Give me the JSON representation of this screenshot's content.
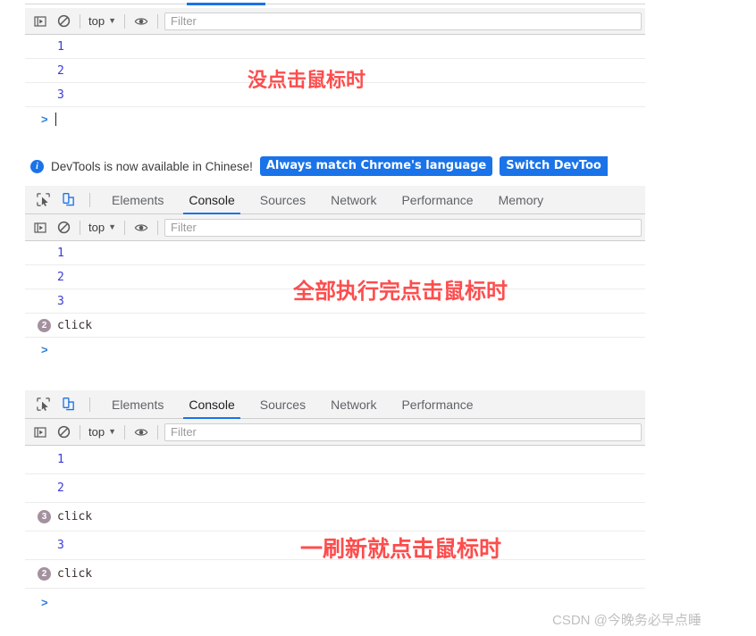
{
  "meta": {
    "watermark": "CSDN @今晚务必早点睡"
  },
  "colors": {
    "accent_blue": "#1a73e8",
    "annotation_red": "#fd4d4d",
    "badge_mauve": "#a4919f",
    "line_number_blue": "#3b3bd6",
    "toolbar_bg": "#f3f3f3"
  },
  "toolbar": {
    "sidebar_toggle_icon": "console-sidebar-icon",
    "clear_icon": "clear-console-icon",
    "context_label": "top",
    "context_caret": "▼",
    "eye_icon": "live-expression-icon",
    "filter_placeholder": "Filter"
  },
  "panel1": {
    "rows": [
      {
        "type": "log",
        "text": "1"
      },
      {
        "type": "log",
        "text": "2"
      },
      {
        "type": "log",
        "text": "3"
      }
    ],
    "prompt": ">",
    "annotation": "没点击鼠标时"
  },
  "notice": {
    "info_glyph": "i",
    "message": "DevTools is now available in Chinese!",
    "buttons": [
      {
        "label": "Always match Chrome's language"
      },
      {
        "label": "Switch DevToo"
      }
    ]
  },
  "panel2": {
    "tabs": [
      {
        "label": "Elements",
        "active": false
      },
      {
        "label": "Console",
        "active": true
      },
      {
        "label": "Sources",
        "active": false
      },
      {
        "label": "Network",
        "active": false
      },
      {
        "label": "Performance",
        "active": false
      },
      {
        "label": "Memory",
        "active": false
      }
    ],
    "inspect_icon": "inspect-element-icon",
    "device_icon": "device-toolbar-icon",
    "rows": [
      {
        "type": "log",
        "text": "1"
      },
      {
        "type": "log",
        "text": "2"
      },
      {
        "type": "log",
        "text": "3"
      },
      {
        "type": "click",
        "count": "2",
        "text": "click"
      }
    ],
    "prompt": ">",
    "annotation": "全部执行完点击鼠标时"
  },
  "panel3": {
    "tabs": [
      {
        "label": "Elements",
        "active": false
      },
      {
        "label": "Console",
        "active": true
      },
      {
        "label": "Sources",
        "active": false
      },
      {
        "label": "Network",
        "active": false
      },
      {
        "label": "Performance",
        "active": false
      }
    ],
    "inspect_icon": "inspect-element-icon",
    "device_icon": "device-toolbar-icon",
    "rows": [
      {
        "type": "log",
        "text": "1"
      },
      {
        "type": "log",
        "text": "2"
      },
      {
        "type": "click",
        "count": "3",
        "text": "click"
      },
      {
        "type": "log",
        "text": "3"
      },
      {
        "type": "click",
        "count": "2",
        "text": "click"
      }
    ],
    "prompt": ">",
    "annotation": "一刷新就点击鼠标时"
  }
}
